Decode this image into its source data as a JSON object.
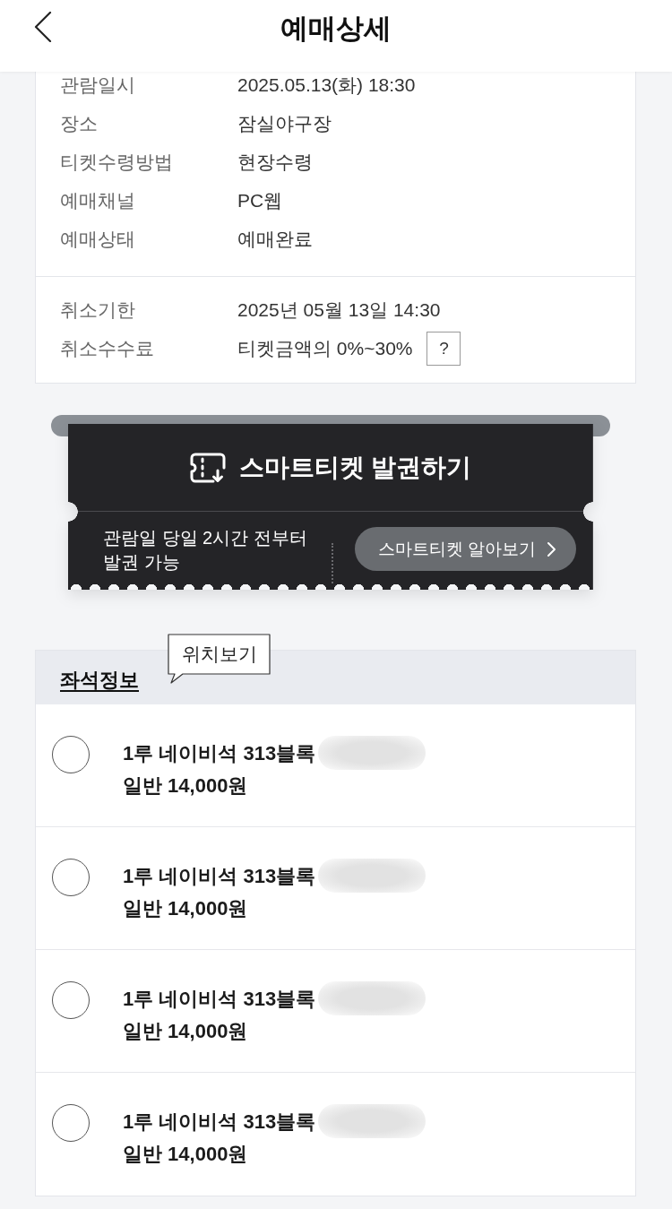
{
  "header": {
    "title": "예매상세"
  },
  "details": {
    "groups": [
      {
        "rows": [
          {
            "label": "관람일시",
            "value": "2025.05.13(화) 18:30"
          },
          {
            "label": "장소",
            "value": "잠실야구장"
          },
          {
            "label": "티켓수령방법",
            "value": "현장수령"
          },
          {
            "label": "예매채널",
            "value": "PC웹"
          },
          {
            "label": "예매상태",
            "value": "예매완료"
          }
        ]
      },
      {
        "rows": [
          {
            "label": "취소기한",
            "value": "2025년 05월 13일 14:30"
          },
          {
            "label": "취소수수료",
            "value": "티켓금액의 0%~30%",
            "help": "?"
          }
        ]
      }
    ]
  },
  "smart_ticket": {
    "title": "스마트티켓 발권하기",
    "note_lines": [
      "관람일 당일 2시간 전부터",
      "발권 가능"
    ],
    "button": "스마트티켓 알아보기"
  },
  "seat_info": {
    "title": "좌석정보",
    "tooltip": "위치보기",
    "seats": [
      {
        "selected": false,
        "seat": "1루 네이비석 313블록",
        "price": "일반 14,000원",
        "redacted": true
      },
      {
        "selected": false,
        "seat": "1루 네이비석 313블록",
        "price": "일반 14,000원",
        "redacted": true
      },
      {
        "selected": false,
        "seat": "1루 네이비석 313블록",
        "price": "일반 14,000원",
        "redacted": true
      },
      {
        "selected": false,
        "seat": "1루 네이비석 313블록",
        "price": "일반 14,000원",
        "redacted": true
      }
    ]
  }
}
